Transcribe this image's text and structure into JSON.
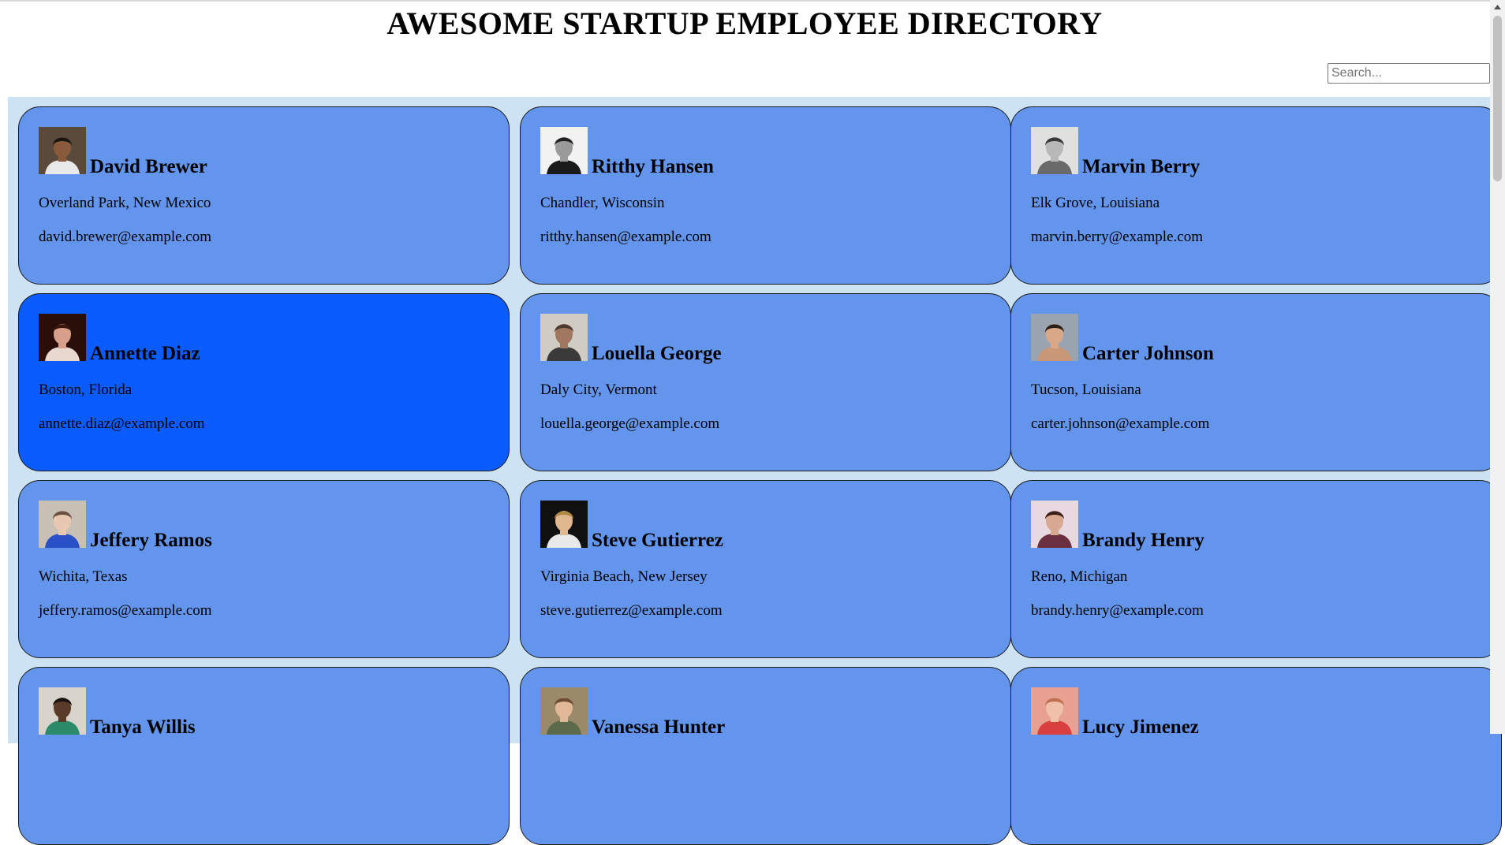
{
  "page": {
    "title": "AWESOME STARTUP EMPLOYEE DIRECTORY"
  },
  "search": {
    "placeholder": "Search...",
    "value": ""
  },
  "colors": {
    "card": "#6495ed",
    "card_selected": "#0a5cff",
    "directory_bg": "#cde3f4"
  },
  "employees": [
    {
      "name": "David Brewer",
      "location": "Overland Park, New Mexico",
      "email": "david.brewer@example.com",
      "avatar": {
        "bg": "#5a4a3c",
        "skin": "#8a5a3c",
        "hair": "#1a1410",
        "shirt": "#e8e8e8"
      }
    },
    {
      "name": "Ritthy Hansen",
      "location": "Chandler, Wisconsin",
      "email": "ritthy.hansen@example.com",
      "avatar": {
        "bg": "#f2f2f2",
        "skin": "#9a9a9a",
        "hair": "#222222",
        "shirt": "#1a1a1a"
      }
    },
    {
      "name": "Marvin Berry",
      "location": "Elk Grove, Louisiana",
      "email": "marvin.berry@example.com",
      "avatar": {
        "bg": "#e0e0e0",
        "skin": "#b8b8b8",
        "hair": "#3a3a3a",
        "shirt": "#6a6a6a"
      }
    },
    {
      "name": "Annette Diaz",
      "location": "Boston, Florida",
      "email": "annette.diaz@example.com",
      "avatar": {
        "bg": "#2a0e0a",
        "skin": "#d8a08a",
        "hair": "#3a160e",
        "shirt": "#e8d8d0"
      }
    },
    {
      "name": "Louella George",
      "location": "Daly City, Vermont",
      "email": "louella.george@example.com",
      "avatar": {
        "bg": "#d0ccc4",
        "skin": "#a07860",
        "hair": "#4a3a30",
        "shirt": "#3a3a3a"
      }
    },
    {
      "name": "Carter Johnson",
      "location": "Tucson, Louisiana",
      "email": "carter.johnson@example.com",
      "avatar": {
        "bg": "#9aa4b0",
        "skin": "#d8a888",
        "hair": "#2a1e18",
        "shirt": "#c89878"
      }
    },
    {
      "name": "Jeffery Ramos",
      "location": "Wichita, Texas",
      "email": "jeffery.ramos@example.com",
      "avatar": {
        "bg": "#c8c0b4",
        "skin": "#e8c8b0",
        "hair": "#6a5040",
        "shirt": "#2a50c8"
      }
    },
    {
      "name": "Steve Gutierrez",
      "location": "Virginia Beach, New Jersey",
      "email": "steve.gutierrez@example.com",
      "avatar": {
        "bg": "#101010",
        "skin": "#e0b890",
        "hair": "#b08848",
        "shirt": "#e8e8e8"
      }
    },
    {
      "name": "Brandy Henry",
      "location": "Reno, Michigan",
      "email": "brandy.henry@example.com",
      "avatar": {
        "bg": "#e8d8e0",
        "skin": "#d8a890",
        "hair": "#3a2018",
        "shirt": "#6a3040"
      }
    },
    {
      "name": "Tanya Willis",
      "location": "",
      "email": "",
      "avatar": {
        "bg": "#d8d4cc",
        "skin": "#5a3a28",
        "hair": "#1a1210",
        "shirt": "#2a8a6a"
      }
    },
    {
      "name": "Vanessa Hunter",
      "location": "",
      "email": "",
      "avatar": {
        "bg": "#9a8a6a",
        "skin": "#e0b898",
        "hair": "#6a4a30",
        "shirt": "#5a6a4a"
      }
    },
    {
      "name": "Lucy Jimenez",
      "location": "",
      "email": "",
      "avatar": {
        "bg": "#e8a090",
        "skin": "#f0c0a8",
        "hair": "#c07050",
        "shirt": "#d84040"
      }
    }
  ]
}
